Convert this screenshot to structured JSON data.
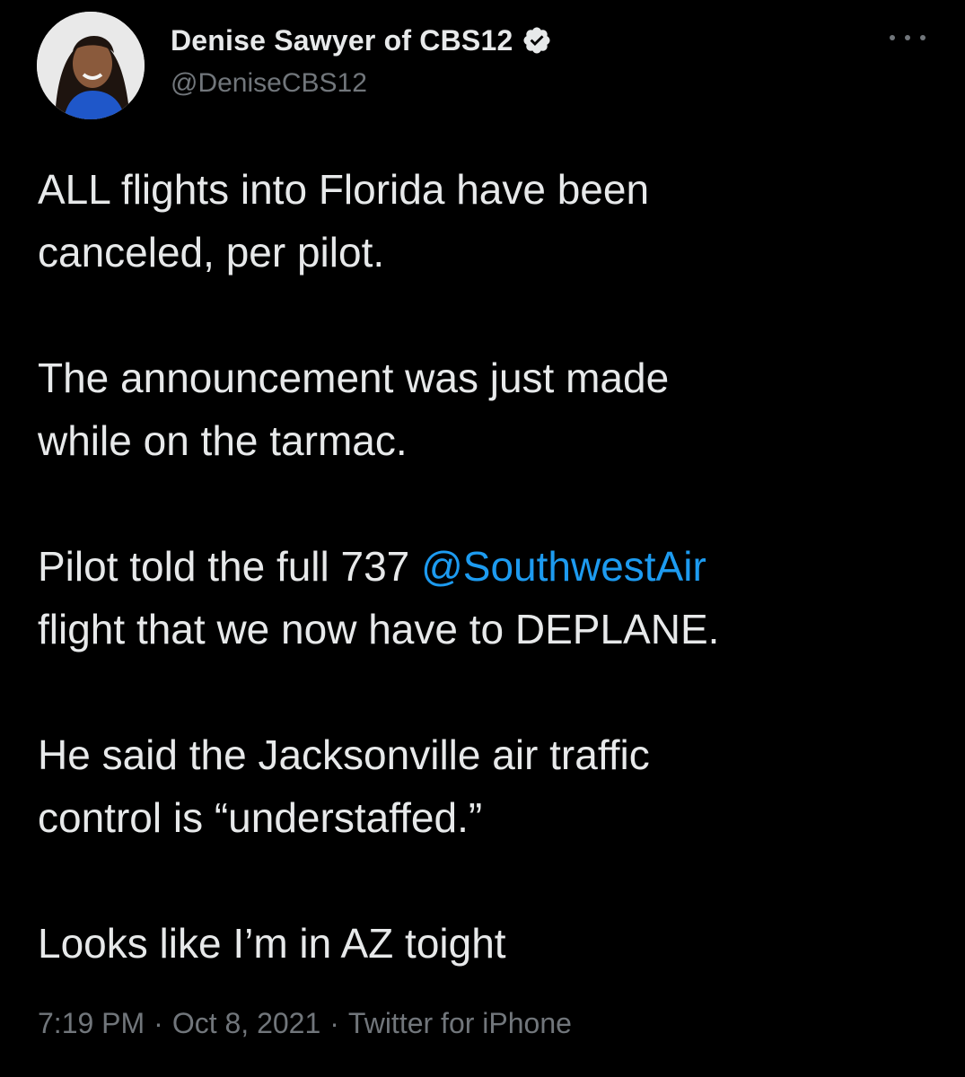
{
  "author": {
    "display_name": "Denise Sawyer of CBS12",
    "handle": "@DeniseCBS12",
    "verified": true
  },
  "tweet": {
    "paragraphs": [
      [
        "ALL flights into Florida have been",
        "canceled, per pilot."
      ],
      [
        "The announcement was just made",
        "while on the tarmac."
      ],
      [
        "Pilot told the full 737 ",
        "@SouthwestAir",
        "flight that we now have to DEPLANE."
      ],
      [
        "He said the Jacksonville air traffic",
        "control is “understaffed.”"
      ],
      [
        "Looks like I’m in AZ toight"
      ]
    ]
  },
  "meta": {
    "time": "7:19 PM",
    "date": "Oct 8, 2021",
    "source": "Twitter for iPhone",
    "separator": "·"
  },
  "colors": {
    "background": "#000000",
    "text": "#e7e9ea",
    "secondary": "#71767b",
    "accent": "#1d9bf0"
  },
  "icons": {
    "verified": "verified-badge-icon",
    "more": "more-options-icon"
  }
}
